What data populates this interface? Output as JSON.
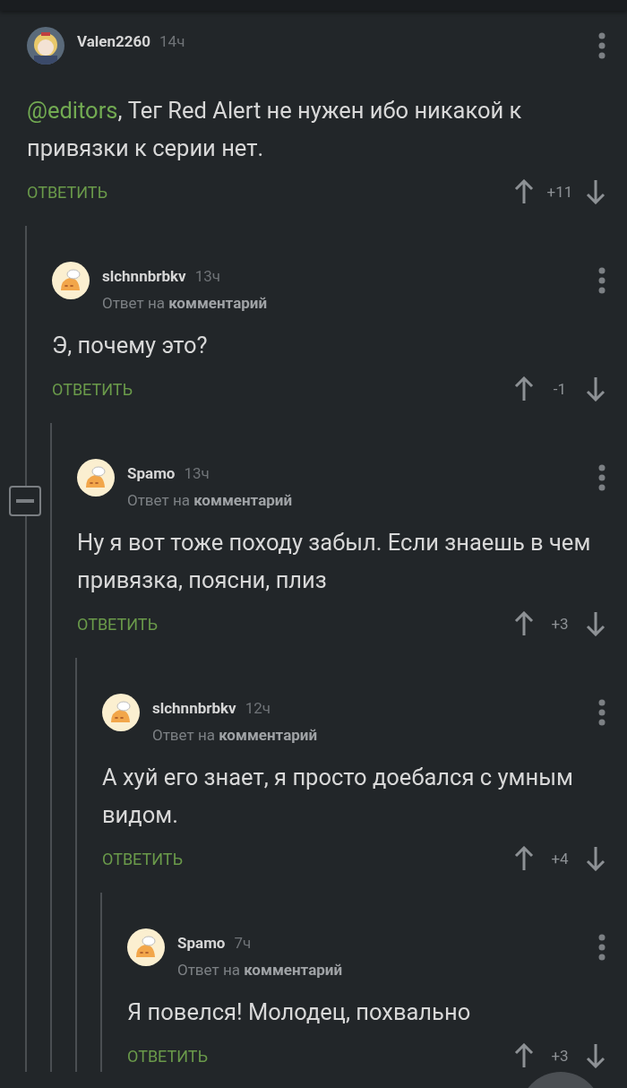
{
  "comments": [
    {
      "author": "Valen2260",
      "time": "14ч",
      "mention": "@editors",
      "text": ", Тег Red Alert не нужен ибо никакой к привязки к серии нет.",
      "reply_label": "ОТВЕТИТЬ",
      "rating": "+11",
      "expanded": true,
      "children": [
        {
          "author": "slchnnbrbkv",
          "time": "13ч",
          "avatar": {
            "kind": "default"
          },
          "reply_to": "Ответ на **комментарий**",
          "text": "Э, почему это?",
          "reply_label": "ОТВЕТИТЬ",
          "rating": "-1",
          "children": [
            {
              "author": "Spamo",
              "time": "13ч",
              "avatar": {
                "kind": "default"
              },
              "reply_to": "Ответ на **комментарий**",
              "text": "Ну я вот тоже походу забыл. Если знаешь в чем привязка, поясни, плиз",
              "reply_label": "ОТВЕТИТЬ",
              "rating": "+3",
              "children": [
                {
                  "author": "slchnnbrbkv",
                  "time": "12ч",
                  "avatar": {
                    "kind": "default"
                  },
                  "reply_to": "Ответ на **комментарий**",
                  "text": "А хуй его знает, я просто доебался с умным видом.",
                  "reply_label": "ОТВЕТИТЬ",
                  "rating": "+4",
                  "children": [
                    {
                      "author": "Spamo",
                      "time": "7ч",
                      "avatar": {
                        "kind": "default"
                      },
                      "reply_to": "Ответ на **комментарий**",
                      "text": "Я повелся! Молодец, похвально",
                      "reply_label": "ОТВЕТИТЬ",
                      "rating": "+3"
                    }
                  ]
                }
              ]
            }
          ]
        }
      ]
    }
  ]
}
